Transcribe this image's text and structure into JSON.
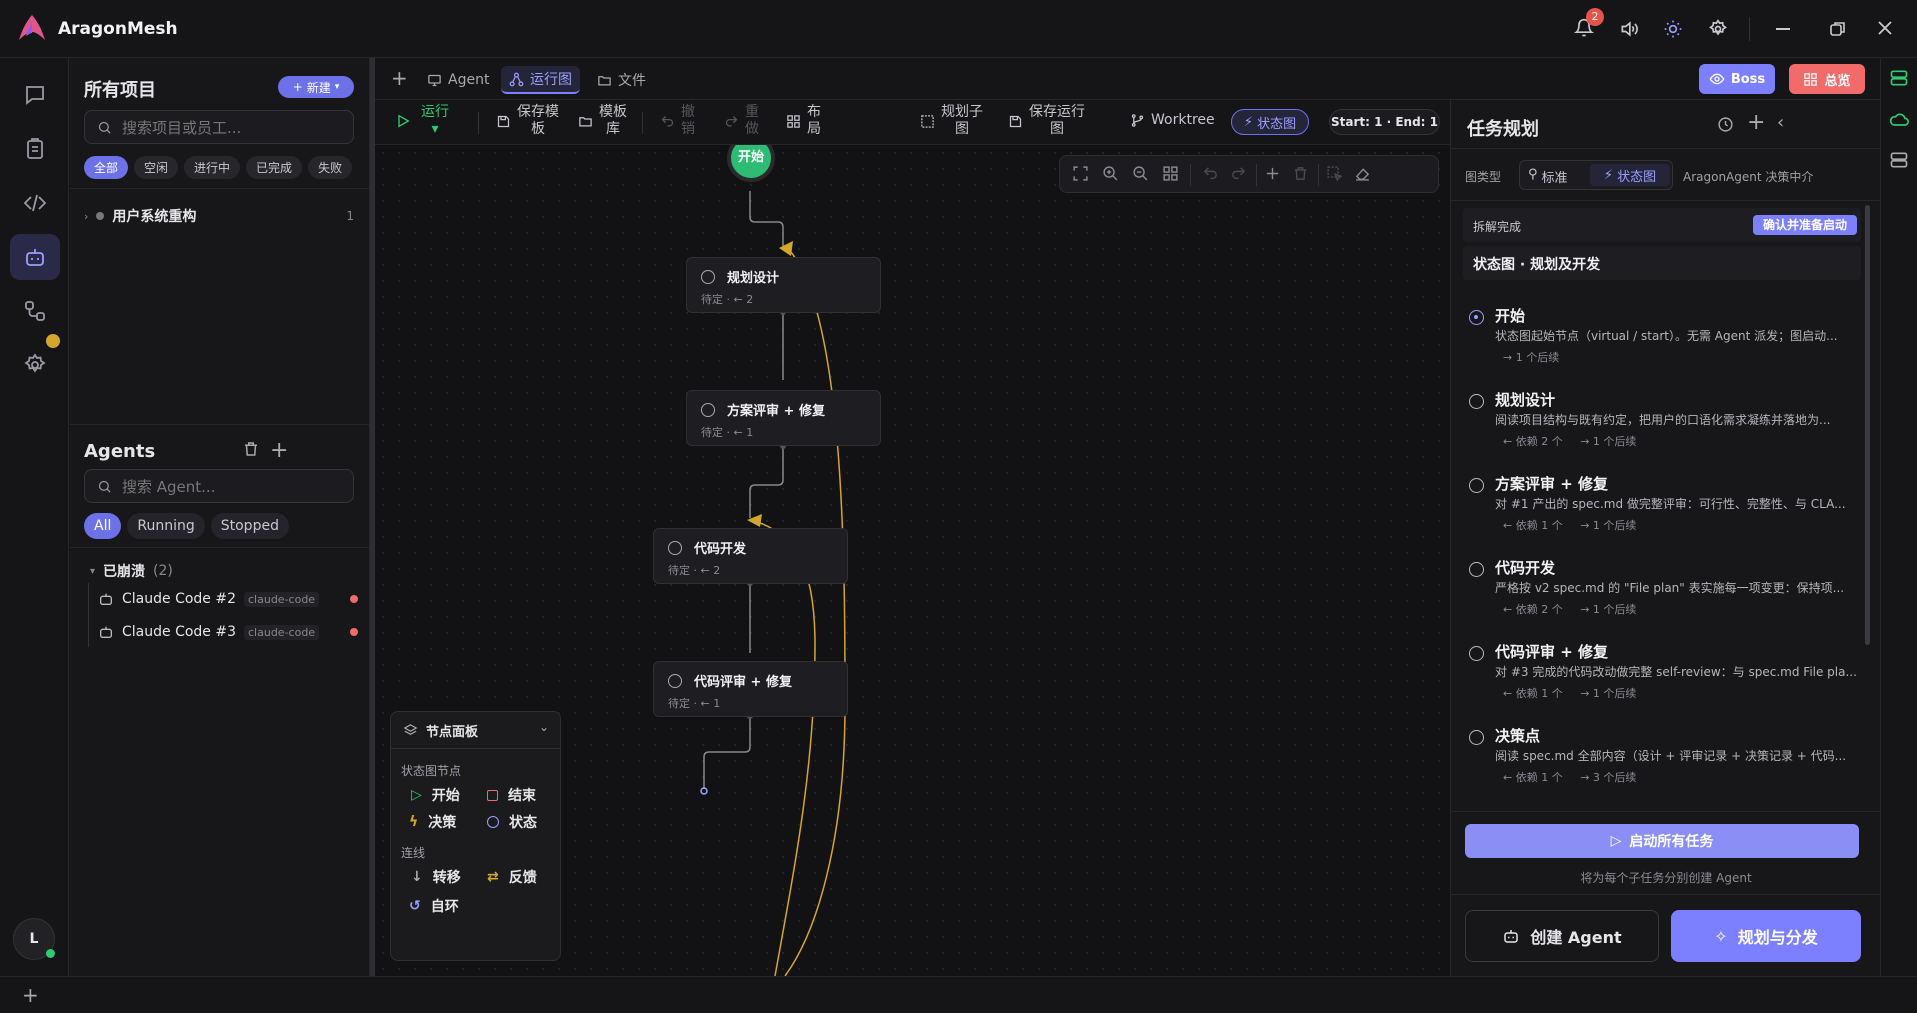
{
  "app": {
    "title": "AragonMesh",
    "notifications": "2"
  },
  "left": {
    "projects_title": "所有项目",
    "new_label": "新建",
    "search_placeholder": "搜索项目或员工...",
    "filters": [
      "全部",
      "空闲",
      "进行中",
      "已完成",
      "失败"
    ],
    "projects": [
      {
        "name": "用户系统重构",
        "count": "1"
      }
    ],
    "agents_title": "Agents",
    "agent_search_placeholder": "搜索 Agent...",
    "agent_filters": [
      "All",
      "Running",
      "Stopped"
    ],
    "group": {
      "label": "已崩溃",
      "count": "(2)"
    },
    "agents": [
      {
        "name": "Claude Code #2",
        "tag": "claude-code"
      },
      {
        "name": "Claude Code #3",
        "tag": "claude-code"
      }
    ],
    "avatar": "L"
  },
  "tabs": [
    {
      "label": "Agent"
    },
    {
      "label": "运行图"
    },
    {
      "label": "文件"
    }
  ],
  "header_buttons": {
    "boss": "Boss",
    "overview": "总览"
  },
  "toolbar": {
    "run": "运行",
    "save_tpl": "保存模\n板",
    "tpl_lib": "模板\n库",
    "undo": "撤\n销",
    "redo": "重\n做",
    "layout": "布\n局",
    "plan_sub": "规划子\n图",
    "save_graph": "保存运行\n图",
    "worktree": "Worktree",
    "state": "状态图",
    "range": "Start: 1 · End: 1"
  },
  "canvas": {
    "start": "开始",
    "nodes": [
      {
        "title": "规划设计",
        "meta": "待定 · ← 2"
      },
      {
        "title": "方案评审 + 修复",
        "meta": "待定 · ← 1"
      },
      {
        "title": "代码开发",
        "meta": "待定 · ← 2"
      },
      {
        "title": "代码评审 + 修复",
        "meta": "待定 · ← 1"
      }
    ]
  },
  "node_panel": {
    "title": "节点面板",
    "section1": "状态图节点",
    "start": "开始",
    "end": "结束",
    "decision": "决策",
    "state": "状态",
    "section2": "连线",
    "transition": "转移",
    "feedback": "反馈",
    "selfloop": "自环"
  },
  "right": {
    "title": "任务规划",
    "graph_type": "图类型",
    "std": "标准",
    "state": "状态图",
    "decider": "AragonAgent 决策中介",
    "status": "拆解完成",
    "confirm": "确认并准备启动",
    "plan_title": "状态图 · 规划及开发",
    "tasks": [
      {
        "title": "开始",
        "desc": "状态图起始节点（virtual / start）。无需 Agent 派发；图启动...",
        "links": "→ 1 个后续"
      },
      {
        "title": "规划设计",
        "desc": "阅读项目结构与既有约定，把用户的口语化需求凝练并落地为...",
        "links": "← 依赖 2 个     → 1 个后续"
      },
      {
        "title": "方案评审 + 修复",
        "desc": "对 #1 产出的 spec.md 做完整评审：可行性、完整性、与 CLA...",
        "links": "← 依赖 1 个     → 1 个后续"
      },
      {
        "title": "代码开发",
        "desc": "严格按 v2 spec.md 的 \"File plan\" 表实施每一项变更：保持项...",
        "links": "← 依赖 2 个     → 1 个后续"
      },
      {
        "title": "代码评审 + 修复",
        "desc": "对 #3 完成的代码改动做完整 self-review：与 spec.md File pla...",
        "links": "← 依赖 1 个     → 1 个后续"
      },
      {
        "title": "决策点",
        "desc": "阅读 spec.md 全部内容（设计 + 评审记录 + 决策记录 + 代码...",
        "links": "← 依赖 1 个     → 3 个后续"
      }
    ],
    "start_all": "启动所有任务",
    "start_hint": "将为每个子任务分别创建 Agent",
    "create_agent": "创建 Agent",
    "plan_dispatch": "规划与分发"
  }
}
